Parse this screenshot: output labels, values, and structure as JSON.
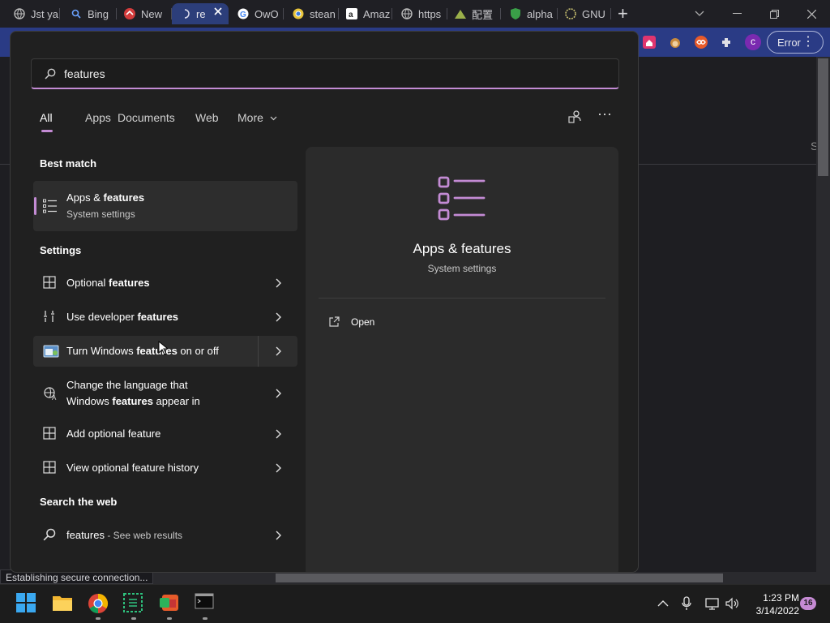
{
  "browser": {
    "tabs": [
      {
        "label": "Jst ya",
        "icon": "globe-icon"
      },
      {
        "label": "Bing",
        "icon": "search-icon"
      },
      {
        "label": "New",
        "icon": "app-icon"
      },
      {
        "label": "re",
        "icon": "loading-icon",
        "active": true
      },
      {
        "label": "OwO",
        "icon": "google-icon"
      },
      {
        "label": "stean",
        "icon": "chrome-icon"
      },
      {
        "label": "Amaz",
        "icon": "amazon-icon"
      },
      {
        "label": "https",
        "icon": "globe-icon"
      },
      {
        "label": "配置",
        "icon": "app-icon"
      },
      {
        "label": "alpha",
        "icon": "shield-icon"
      },
      {
        "label": "GNU",
        "icon": "gnu-icon"
      }
    ],
    "new_tab_label": "+",
    "error_button": "Error",
    "status_text": "Establishing secure connection...",
    "page_edge_letter": "S",
    "profile_initial": "c"
  },
  "search": {
    "query": "features",
    "filters": [
      "All",
      "Apps",
      "Documents",
      "Web",
      "More"
    ],
    "active_filter": "All"
  },
  "results": {
    "best_match_header": "Best match",
    "best_match": {
      "title_prefix": "Apps & ",
      "title_bold": "features",
      "subtitle": "System settings"
    },
    "settings_header": "Settings",
    "settings": [
      {
        "prefix": "Optional ",
        "bold": "features",
        "suffix": "",
        "icon": "optional-features-icon"
      },
      {
        "prefix": "Use developer ",
        "bold": "features",
        "suffix": "",
        "icon": "developer-tools-icon"
      },
      {
        "prefix": "Turn Windows ",
        "bold": "features",
        "suffix": " on or off",
        "icon": "control-panel-icon"
      },
      {
        "prefix": "Change the language that",
        "line2_prefix": "Windows ",
        "bold": "features",
        "suffix": " appear in",
        "icon": "language-icon"
      },
      {
        "prefix": "Add optional feature",
        "bold": "",
        "suffix": "",
        "icon": "optional-features-icon"
      },
      {
        "prefix": "View optional feature history",
        "bold": "",
        "suffix": "",
        "icon": "optional-features-icon"
      }
    ],
    "web_header": "Search the web",
    "web": {
      "query": "features",
      "hint": " - See web results"
    }
  },
  "preview": {
    "title": "Apps & features",
    "subtitle": "System settings",
    "open_label": "Open"
  },
  "taskbar": {
    "apps": [
      "windows-start-icon",
      "file-explorer-icon",
      "chrome-icon",
      "terminal-green-icon",
      "office-icon",
      "command-prompt-icon"
    ],
    "clock_time": "1:23 PM",
    "clock_date": "3/14/2022",
    "notification_count": "16"
  },
  "colors": {
    "accent": "#c38bd4",
    "browser_toolbar": "#2a3b85",
    "flyout_bg": "#202020",
    "taskbar_bg": "#1c1c1c"
  }
}
